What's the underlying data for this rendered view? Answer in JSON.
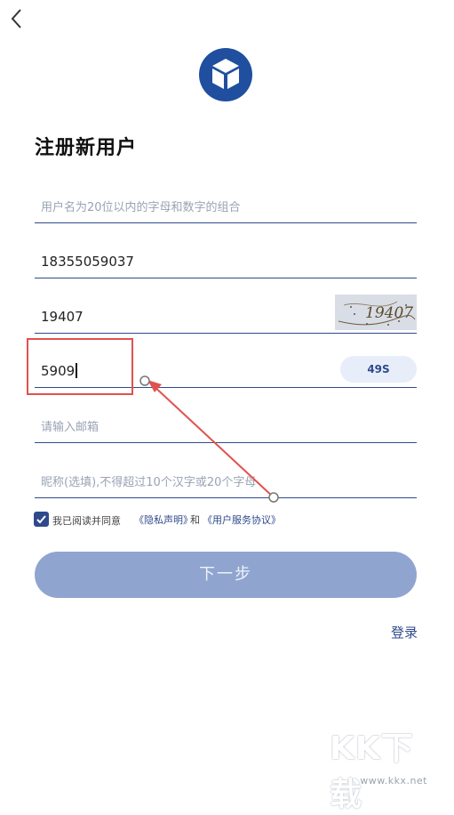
{
  "header": {
    "back_icon": "chevron-left-icon"
  },
  "logo": {
    "icon": "cube-logo-icon",
    "color": "#1f4f9e"
  },
  "page": {
    "title": "注册新用户"
  },
  "form": {
    "username": {
      "value": "",
      "placeholder": "用户名为20位以内的字母和数字的组合"
    },
    "phone": {
      "value": "18355059037"
    },
    "captcha": {
      "value": "19407",
      "image_text": "19407"
    },
    "sms_code": {
      "value": "5909",
      "countdown": "49S"
    },
    "email": {
      "value": "",
      "placeholder": "请输入邮箱"
    },
    "nickname": {
      "value": "",
      "placeholder": "昵称(选填),不得超过10个汉字或20个字母"
    }
  },
  "agreement": {
    "checked": true,
    "prefix": "我已阅读并同意",
    "privacy_link": "《隐私声明》",
    "and": "和",
    "service_link": "《用户服务协议》"
  },
  "actions": {
    "next": "下一步",
    "login": "登录"
  },
  "annotation": {
    "highlight_color": "#e0524f"
  },
  "watermark": {
    "brand": "KK下载",
    "url": "www.kkx.net"
  },
  "colors": {
    "accent": "#2f4a8c",
    "button_disabled": "#8fa5cf"
  }
}
